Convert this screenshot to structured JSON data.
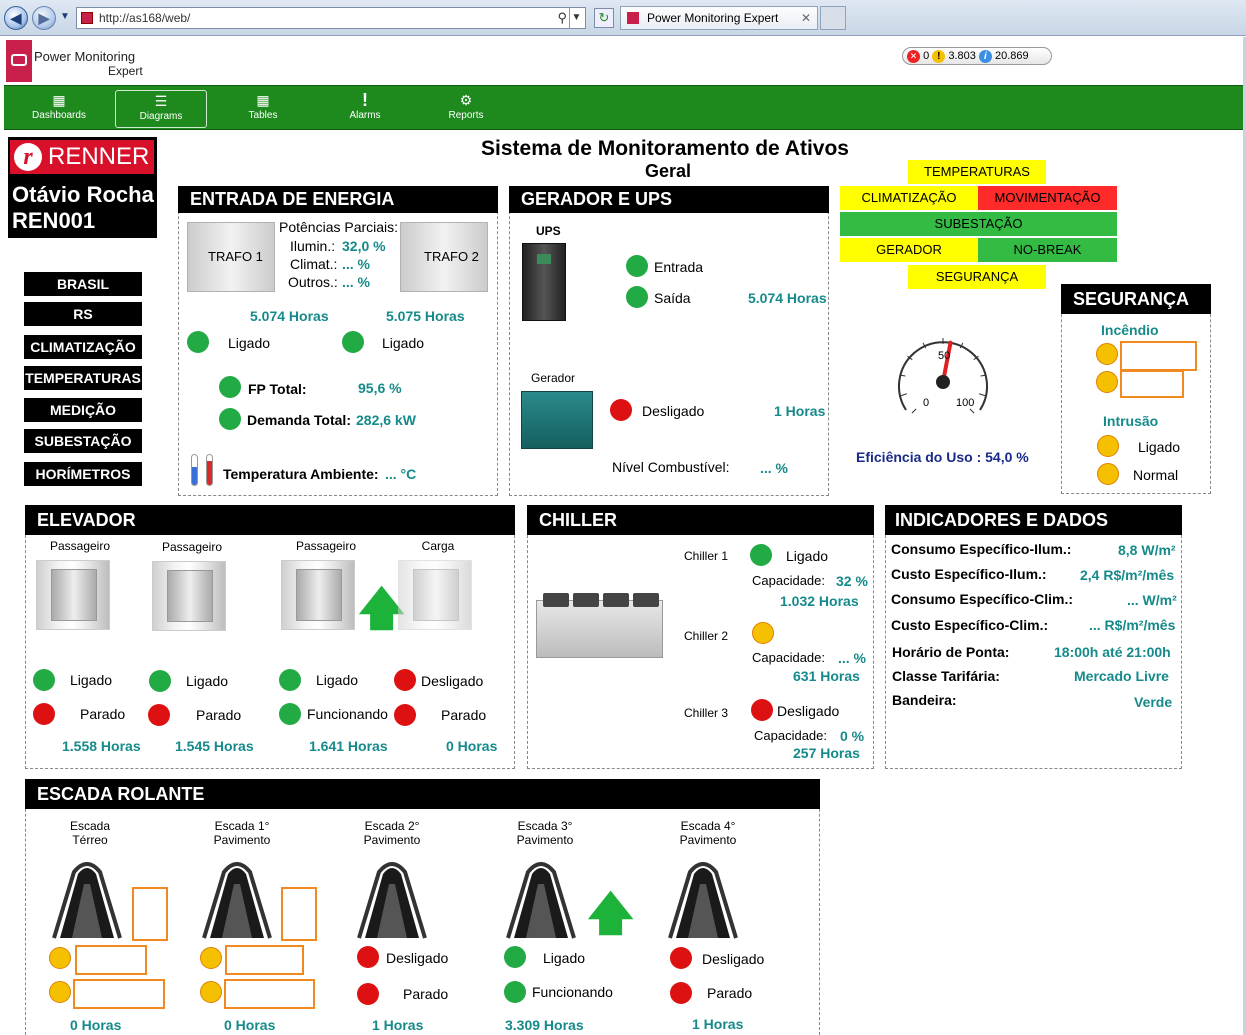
{
  "browser": {
    "url": "http://as168/web/",
    "tab_title": "Power Monitoring Expert"
  },
  "app": {
    "name_line1": "Power Monitoring",
    "name_line2": "Expert"
  },
  "notifications": {
    "errors": "0",
    "warnings": "3.803",
    "info": "20.869"
  },
  "menu": [
    {
      "label": "Dashboards",
      "icon": "dashboard-icon"
    },
    {
      "label": "Diagrams",
      "icon": "diagram-icon"
    },
    {
      "label": "Tables",
      "icon": "table-icon"
    },
    {
      "label": "Alarms",
      "icon": "alarm-icon"
    },
    {
      "label": "Reports",
      "icon": "reports-icon"
    }
  ],
  "page": {
    "title": "Sistema de Monitoramento de Ativos",
    "subtitle": "Geral"
  },
  "site": {
    "brand": "RENNER",
    "name": "Otávio Rocha",
    "code": "REN001"
  },
  "sidebar": [
    "BRASIL",
    "RS",
    "CLIMATIZAÇÃO",
    "TEMPERATURAS",
    "MEDIÇÃO",
    "SUBESTAÇÃO",
    "HORÍMETROS"
  ],
  "legend": {
    "temperaturas": "TEMPERATURAS",
    "climatizacao": "CLIMATIZAÇÃO",
    "movimentacao": "MOVIMENTAÇÃO",
    "subestacao": "SUBESTAÇÃO",
    "gerador": "GERADOR",
    "nobreak": "NO-BREAK",
    "seguranca": "SEGURANÇA"
  },
  "energia": {
    "header": "ENTRADA DE ENERGIA",
    "trafo1": "TRAFO 1",
    "trafo2": "TRAFO 2",
    "parciais": "Potências Parciais:",
    "ilum_l": "Ilumin.:",
    "ilum_v": "32,0 %",
    "clim_l": "Climat.:",
    "clim_v": "... %",
    "outros_l": "Outros.:",
    "outros_v": "... %",
    "horas1": "5.074 Horas",
    "horas2": "5.075 Horas",
    "status1": "Ligado",
    "status2": "Ligado",
    "fp_l": "FP Total:",
    "fp_v": "95,6 %",
    "dem_l": "Demanda Total:",
    "dem_v": "282,6 kW",
    "temp_l": "Temperatura Ambiente:",
    "temp_v": "... °C"
  },
  "gerador": {
    "header": "GERADOR E UPS",
    "ups": "UPS",
    "entrada": "Entrada",
    "saida": "Saída",
    "ups_horas": "5.074 Horas",
    "gerador": "Gerador",
    "ger_status": "Desligado",
    "ger_horas": "1 Horas",
    "comb_l": "Nível Combustível:",
    "comb_v": "... %"
  },
  "gauge": {
    "label": "Eficiência do Uso : 54,0 %",
    "value": 54,
    "t0": "0",
    "t50": "50",
    "t100": "100"
  },
  "seguranca": {
    "header": "SEGURANÇA",
    "incendio": "Incêndio",
    "intrusao": "Intrusão",
    "st1": "Ligado",
    "st2": "Normal"
  },
  "elevador": {
    "header": "ELEVADOR",
    "items": [
      {
        "name": "Passageiro",
        "s1": "Ligado",
        "s2": "Parado",
        "horas": "1.558 Horas"
      },
      {
        "name": "Passageiro",
        "s1": "Ligado",
        "s2": "Parado",
        "horas": "1.545 Horas"
      },
      {
        "name": "Passageiro",
        "s1": "Ligado",
        "s2": "Funcionando",
        "horas": "1.641 Horas"
      },
      {
        "name": "Carga",
        "s1": "Desligado",
        "s2": "Parado",
        "horas": "0 Horas"
      }
    ]
  },
  "chiller": {
    "header": "CHILLER",
    "c1": "Chiller 1",
    "c1_status": "Ligado",
    "c1_cap_l": "Capacidade:",
    "c1_cap_v": "32 %",
    "c1_horas": "1.032 Horas",
    "c2": "Chiller 2",
    "c2_cap_l": "Capacidade:",
    "c2_cap_v": "... %",
    "c2_horas": "631 Horas",
    "c3": "Chiller 3",
    "c3_status": "Desligado",
    "c3_cap_l": "Capacidade:",
    "c3_cap_v": "0 %",
    "c3_horas": "257 Horas"
  },
  "indicadores": {
    "header": "INDICADORES E DADOS",
    "rows": [
      {
        "l": "Consumo Específico-Ilum.:",
        "v": "8,8 W/m²"
      },
      {
        "l": "Custo Específico-Ilum.:",
        "v": "2,4 R$/m²/mês"
      },
      {
        "l": "Consumo Específico-Clim.:",
        "v": "... W/m²"
      },
      {
        "l": "Custo Específico-Clim.:",
        "v": "... R$/m²/mês"
      },
      {
        "l": "Horário de Ponta:",
        "v": "18:00h até 21:00h"
      },
      {
        "l": "Classe Tarifária:",
        "v": "Mercado Livre"
      },
      {
        "l": "Bandeira:",
        "v": "Verde"
      }
    ]
  },
  "escada": {
    "header": "ESCADA ROLANTE",
    "items": [
      {
        "l1": "Escada",
        "l2": "Térreo",
        "horas": "0 Horas"
      },
      {
        "l1": "Escada 1°",
        "l2": "Pavimento",
        "horas": "0 Horas"
      },
      {
        "l1": "Escada 2°",
        "l2": "Pavimento",
        "s1": "Desligado",
        "s2": "Parado",
        "horas": "1 Horas"
      },
      {
        "l1": "Escada 3°",
        "l2": "Pavimento",
        "s1": "Ligado",
        "s2": "Funcionando",
        "horas": "3.309 Horas"
      },
      {
        "l1": "Escada 4°",
        "l2": "Pavimento",
        "s1": "Desligado",
        "s2": "Parado",
        "horas": "1 Horas"
      }
    ]
  },
  "colors": {
    "menu_green": "#1e8a1e",
    "teal": "#168a8a",
    "status_green": "#22aa44",
    "status_red": "#dd1111",
    "status_yellow": "#f5c000",
    "box_orange": "#f08a20"
  }
}
